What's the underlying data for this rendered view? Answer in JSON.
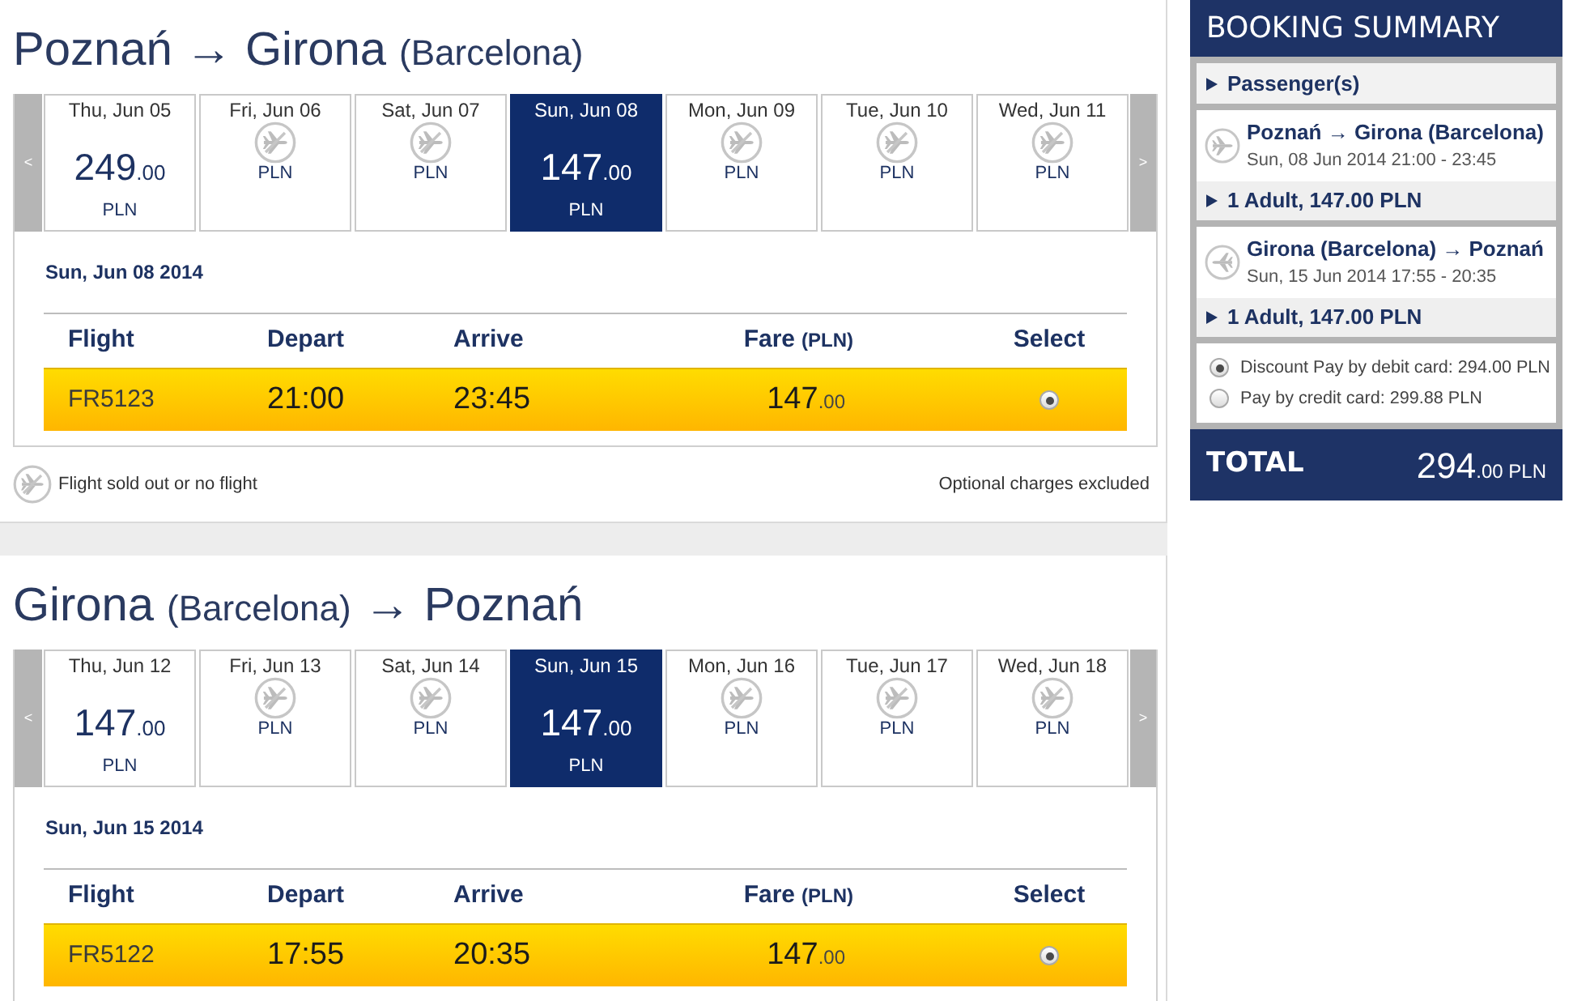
{
  "journeys": [
    {
      "title": [
        {
          "text": "Poznań → Girona",
          "kind": "main"
        },
        {
          "text": "(Barcelona)",
          "kind": "note"
        }
      ],
      "prev_label": "<",
      "next_label": ">",
      "dates": [
        {
          "day": "Thu, Jun 05",
          "available": true,
          "price": "249",
          "decimals": ".00",
          "currency": "PLN",
          "selected": false
        },
        {
          "day": "Fri, Jun 06",
          "available": false,
          "currency": "PLN",
          "selected": false
        },
        {
          "day": "Sat, Jun 07",
          "available": false,
          "currency": "PLN",
          "selected": false
        },
        {
          "day": "Sun, Jun 08",
          "available": true,
          "price": "147",
          "decimals": ".00",
          "currency": "PLN",
          "selected": true
        },
        {
          "day": "Mon, Jun 09",
          "available": false,
          "currency": "PLN",
          "selected": false
        },
        {
          "day": "Tue, Jun 10",
          "available": false,
          "currency": "PLN",
          "selected": false
        },
        {
          "day": "Wed, Jun 11",
          "available": false,
          "currency": "PLN",
          "selected": false
        }
      ],
      "date_heading": "Sun, Jun 08 2014",
      "columns": [
        {
          "label": "Flight"
        },
        {
          "label": "Depart"
        },
        {
          "label": "Arrive"
        },
        {
          "label": "Fare",
          "unit": "(PLN)"
        },
        {
          "label": "Select"
        }
      ],
      "rows": [
        {
          "flight": "FR5123",
          "depart": "21:00",
          "arrive": "23:45",
          "fare": "147",
          "fare_decimals": ".00",
          "selected": true
        }
      ],
      "legend": "Flight sold out or no flight",
      "note": "Optional charges excluded"
    },
    {
      "title": [
        {
          "text": "Girona",
          "kind": "main"
        },
        {
          "text": "(Barcelona)",
          "kind": "note"
        },
        {
          "text": "→ Poznań",
          "kind": "main"
        }
      ],
      "prev_label": "<",
      "next_label": ">",
      "dates": [
        {
          "day": "Thu, Jun 12",
          "available": true,
          "price": "147",
          "decimals": ".00",
          "currency": "PLN",
          "selected": false
        },
        {
          "day": "Fri, Jun 13",
          "available": false,
          "currency": "PLN",
          "selected": false
        },
        {
          "day": "Sat, Jun 14",
          "available": false,
          "currency": "PLN",
          "selected": false
        },
        {
          "day": "Sun, Jun 15",
          "available": true,
          "price": "147",
          "decimals": ".00",
          "currency": "PLN",
          "selected": true
        },
        {
          "day": "Mon, Jun 16",
          "available": false,
          "currency": "PLN",
          "selected": false
        },
        {
          "day": "Tue, Jun 17",
          "available": false,
          "currency": "PLN",
          "selected": false
        },
        {
          "day": "Wed, Jun 18",
          "available": false,
          "currency": "PLN",
          "selected": false
        }
      ],
      "date_heading": "Sun, Jun 15 2014",
      "columns": [
        {
          "label": "Flight"
        },
        {
          "label": "Depart"
        },
        {
          "label": "Arrive"
        },
        {
          "label": "Fare",
          "unit": "(PLN)"
        },
        {
          "label": "Select"
        }
      ],
      "rows": [
        {
          "flight": "FR5122",
          "depart": "17:55",
          "arrive": "20:35",
          "fare": "147",
          "fare_decimals": ".00",
          "selected": true
        }
      ]
    }
  ],
  "summary": {
    "title": "BOOKING SUMMARY",
    "passengers": "Passenger(s)",
    "flights": [
      {
        "kind": "outbound",
        "route": "Poznań → Girona (Barcelona)",
        "time": "Sun, 08 Jun 2014 21:00 - 23:45",
        "fare_line": "1 Adult, 147.00 PLN"
      },
      {
        "kind": "return",
        "route": "Girona (Barcelona) → Poznań",
        "time": "Sun, 15 Jun 2014 17:55 - 20:35",
        "fare_line": "1 Adult, 147.00 PLN"
      }
    ],
    "payment_options": [
      {
        "label": "Discount Pay by debit card: 294.00 PLN",
        "selected": true
      },
      {
        "label": "Pay by credit card: 299.88 PLN",
        "selected": false
      }
    ],
    "total": {
      "label": "TOTAL",
      "amount": "294",
      "decimals": ".00",
      "currency": "PLN"
    }
  }
}
